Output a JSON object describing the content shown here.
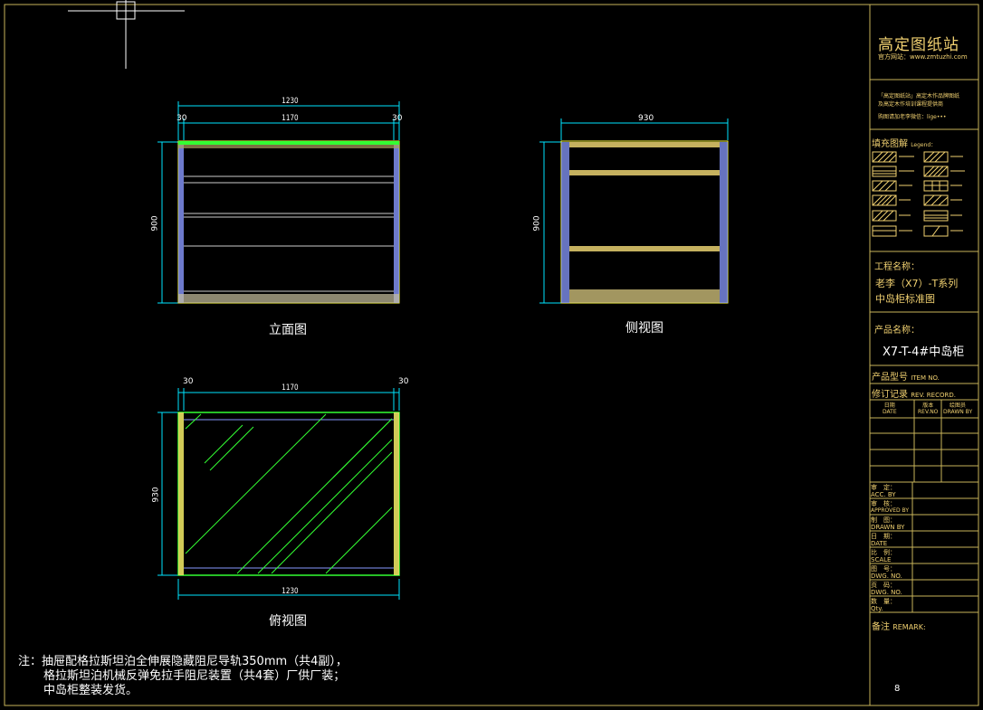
{
  "colors": {
    "frame": "#c8b45a",
    "dim": "#00e5ff",
    "yellow": "#ffff40",
    "green": "#33ff33",
    "blue": "#8899ff",
    "title": "#f0d070"
  },
  "views": {
    "elevation": {
      "caption": "立面图",
      "dim_total": "1230",
      "dim_left": "30",
      "dim_mid": "1170",
      "dim_right": "30",
      "dim_height": "900"
    },
    "side": {
      "caption": "侧视图",
      "dim_width": "930",
      "dim_height": "900"
    },
    "top": {
      "caption": "俯视图",
      "dim_left": "30",
      "dim_mid": "1170",
      "dim_right": "30",
      "dim_depth": "930",
      "dim_bottom": "1230"
    }
  },
  "notes": [
    "注：抽屉配格拉斯坦泊全伸展隐藏阻尼导轨350mm（共4副），",
    "格拉斯坦泊机械反弹免拉手阻尼装置（共4套）厂供厂装；",
    "中岛柜整装发货。"
  ],
  "title_block": {
    "brand": "高定图纸站",
    "website": "官方网站：www.zmtuzhi.com",
    "desc_line1": "「高定图纸站」高定木作品牌图纸",
    "desc_line2": "及高定木作培训课程提供商",
    "desc_line3": "购图请加老李微信：lige•••",
    "legend_label": "填充图解",
    "legend_label_en": "Legend：",
    "project_label": "工程名称：",
    "project_name_1": "老李（X7）-T系列",
    "project_name_2": "中岛柜标准图",
    "product_label": "产品名称：",
    "product_name": "X7-T-4#中岛柜",
    "item_label": "产品型号",
    "item_label_en": "ITEM NO.",
    "rev_label": "修订记录",
    "rev_label_en": "REV. RECORD.",
    "rev_col1_cn": "日期",
    "rev_col1_en": "DATE",
    "rev_col2_cn": "版本",
    "rev_col2_en": "REV.NO",
    "rev_col3_cn": "绘图员",
    "rev_col3_en": "DRAWN BY",
    "approvals": [
      {
        "cn": "审　定：",
        "en": "ACC. BY"
      },
      {
        "cn": "审　核：",
        "en": "APPROVED BY"
      },
      {
        "cn": "制　图：",
        "en": "DRAWN BY"
      },
      {
        "cn": "日　期：",
        "en": "DATE"
      },
      {
        "cn": "比　例：",
        "en": "SCALE"
      },
      {
        "cn": "图　号：",
        "en": "DWG. NO."
      },
      {
        "cn": "页　码：",
        "en": "DWG. NO."
      },
      {
        "cn": "数　量：",
        "en": "Qty."
      }
    ],
    "remark_label": "备注",
    "remark_label_en": "REMARK:",
    "page_number": "8"
  }
}
